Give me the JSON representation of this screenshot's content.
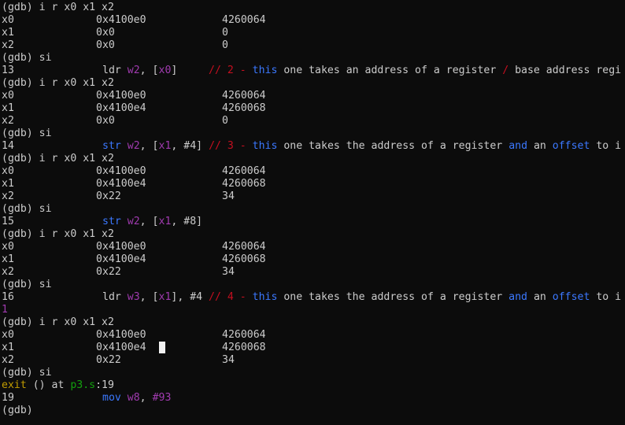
{
  "terminal": {
    "line0_text": "(gdb) i r x0 x1 x2",
    "reg_a": [
      {
        "name": "x0",
        "hex": "0x4100e0",
        "dec": "4260064"
      },
      {
        "name": "x1",
        "hex": "0x0",
        "dec": "0"
      },
      {
        "name": "x2",
        "hex": "0x0",
        "dec": "0"
      }
    ],
    "si_1": "(gdb) si",
    "src_13": {
      "num": "13",
      "op": "ldr",
      "r1": "w2",
      ", [": ", [",
      "r2": "x0",
      "close": "]",
      "comment": "// 2 - ",
      "kw": "this",
      "t1": " one takes an address of a register ",
      "slash": "/",
      "t2": " base address regi"
    },
    "cmd_b": "(gdb) i r x0 x1 x2",
    "reg_b": [
      {
        "name": "x0",
        "hex": "0x4100e0",
        "dec": "4260064"
      },
      {
        "name": "x1",
        "hex": "0x4100e4",
        "dec": "4260068"
      },
      {
        "name": "x2",
        "hex": "0x0",
        "dec": "0"
      }
    ],
    "si_2": "(gdb) si",
    "src_14": {
      "num": "14",
      "op": "str",
      "r1": "w2",
      "sep1": ", [",
      "r2": "x1",
      "sep2": ", ",
      "imm": "#4",
      "close": "]",
      "comment": "// 3 - ",
      "kw": "this",
      "t1": " one takes the address of a register ",
      "and": "and",
      "t2": " an ",
      "offset": "offset",
      "t3": " to i"
    },
    "cmd_c": "(gdb) i r x0 x1 x2",
    "reg_c": [
      {
        "name": "x0",
        "hex": "0x4100e0",
        "dec": "4260064"
      },
      {
        "name": "x1",
        "hex": "0x4100e4",
        "dec": "4260068"
      },
      {
        "name": "x2",
        "hex": "0x22",
        "dec": "34"
      }
    ],
    "si_3": "(gdb) si",
    "src_15": {
      "num": "15",
      "op": "str",
      "r1": "w2",
      "sep1": ", [",
      "r2": "x1",
      "sep2": ", ",
      "imm": "#8",
      "close": "]"
    },
    "cmd_d": "(gdb) i r x0 x1 x2",
    "reg_d": [
      {
        "name": "x0",
        "hex": "0x4100e0",
        "dec": "4260064"
      },
      {
        "name": "x1",
        "hex": "0x4100e4",
        "dec": "4260068"
      },
      {
        "name": "x2",
        "hex": "0x22",
        "dec": "34"
      }
    ],
    "si_4": "(gdb) si",
    "src_16": {
      "num": "16",
      "op": "ldr",
      "r1": "w3",
      "sep1": ", [",
      "r2": "x1",
      "sep2": "], ",
      "imm": "#4",
      "comment": " // 4 - ",
      "kw": "this",
      "t1": " one takes the address of a register ",
      "and": "and",
      "t2": " an ",
      "offset": "offset",
      "t3": " to i"
    },
    "wrap_16": "1",
    "cmd_e": "(gdb) i r x0 x1 x2",
    "reg_e": [
      {
        "name": "x0",
        "hex": "0x4100e0",
        "dec": "4260064"
      },
      {
        "name": "x1",
        "hex": "0x4100e4",
        "dec": "4260068"
      },
      {
        "name": "x2",
        "hex": "0x22",
        "dec": "34"
      }
    ],
    "si_5": "(gdb) si",
    "exit_line": {
      "fn": "exit",
      "mid": " () at ",
      "file": "p3.s",
      "rest": ":19"
    },
    "src_19": {
      "num": "19",
      "op": "mov",
      "r1": "w8",
      "sep1": ", ",
      "imm": "#93"
    },
    "prompt": "(gdb)"
  },
  "colors": {
    "background": "#0c0c0c",
    "text": "#cccccc",
    "keyword": "#3b78ff",
    "register": "#a13bb0",
    "comment": "#c50f1f",
    "function": "#c19c00",
    "file": "#13a10e"
  }
}
